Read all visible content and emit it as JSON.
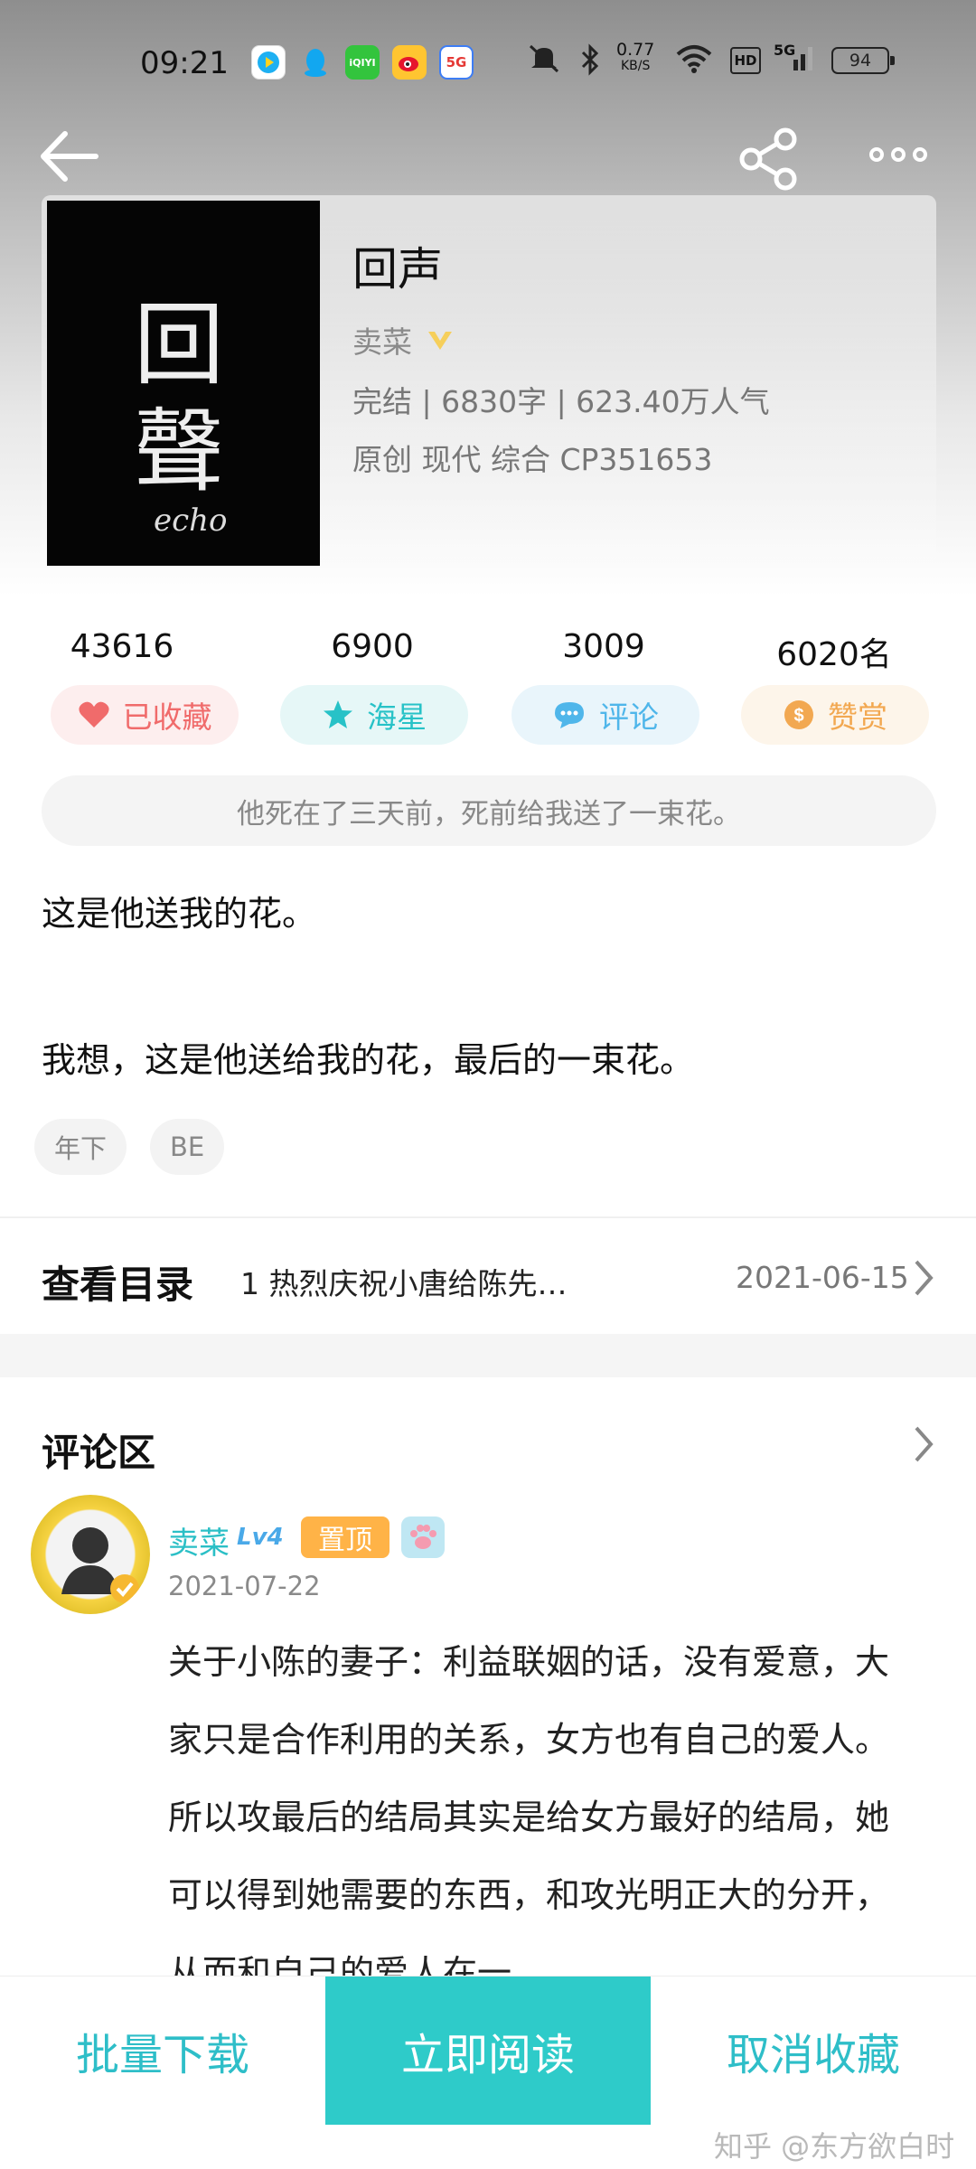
{
  "status_bar": {
    "time": "09:21",
    "net_speed_top": "0.77",
    "net_speed_bottom": "KB/S",
    "hd": "HD",
    "signal": "5G",
    "battery": "94",
    "app_icons": [
      "video-app-icon",
      "qq-icon",
      "iqiyi-icon",
      "weibo-icon",
      "5g-app-icon"
    ],
    "iqiyi_label": "iQIYI",
    "fiveg_label": "5G"
  },
  "nav": {
    "back": "back-arrow-icon",
    "share": "share-icon",
    "more": "more-icon"
  },
  "book": {
    "cover_chars": [
      "回",
      "聲"
    ],
    "cover_script": "echo",
    "title": "回声",
    "author": "卖菜",
    "status_line": "完结 | 6830字 | 623.40万人气",
    "category_line": "原创  现代  综合  CP351653"
  },
  "stats": [
    {
      "count": "43616",
      "label": "已收藏",
      "color": "#f06b6b",
      "bg": "#fdeeee",
      "icon": "heart-icon"
    },
    {
      "count": "6900",
      "label": "海星",
      "color": "#27c2c7",
      "bg": "#e6f7f7",
      "icon": "star-icon"
    },
    {
      "count": "3009",
      "label": "评论",
      "color": "#4fb6ea",
      "bg": "#e9f5fb",
      "icon": "comment-icon"
    },
    {
      "count": "6020名",
      "label": "赞赏",
      "color": "#f2a851",
      "bg": "#fdf5ea",
      "icon": "coin-icon"
    }
  ],
  "summary": "他死在了三天前，死前给我送了一束花。",
  "intro": [
    "这是他送我的花。",
    "我想，这是他送给我的花，最后的一束花。"
  ],
  "tags": [
    "年下",
    "BE"
  ],
  "catalog": {
    "title": "查看目录",
    "latest": "1 热烈庆祝小唐给陈先…",
    "date": "2021-06-15"
  },
  "comments": {
    "title": "评论区",
    "items": [
      {
        "user": "卖菜",
        "level": "Lv4",
        "pin": "置顶",
        "date": "2021-07-22",
        "text": "关于小陈的妻子：利益联姻的话，没有爱意，大家只是合作利用的关系，女方也有自己的爱人。所以攻最后的结局其实是给女方最好的结局，她可以得到她需要的东西，和攻光明正大的分开，从而和自己的爱人在一"
      }
    ]
  },
  "bottom": {
    "download": "批量下载",
    "read": "立即阅读",
    "uncollect": "取消收藏",
    "accent": "#2ecbc9"
  },
  "watermark": "知乎 @东方欲白时"
}
